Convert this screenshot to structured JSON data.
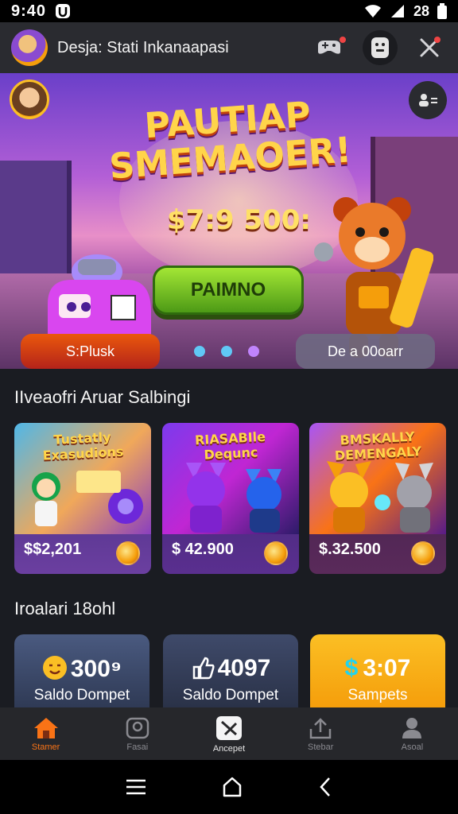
{
  "status_bar": {
    "time": "9:40",
    "battery_text": "28"
  },
  "app_bar": {
    "title": "Desja: Stati Inkanaapasi"
  },
  "hero": {
    "title_line1": "PAUTIAP",
    "title_line2": "SMEMAOER!",
    "prize": "$7:9 500:",
    "play_label": "PAIMNO",
    "left_button": "S:Plusk",
    "right_button": "De a 00oarr",
    "dot_colors": [
      "#60c8f5",
      "#60c8f5",
      "#c084fc"
    ]
  },
  "section_games": {
    "title": "IIveaofri Aruar Salbingi",
    "cards": [
      {
        "title": "Tustatly Exasudions",
        "price": "$$2,201"
      },
      {
        "title": "RIASABIle Dequnc",
        "price": "$ 42.900"
      },
      {
        "title": "BMSKALLY DEMENGALY",
        "price": "$.32.500"
      }
    ]
  },
  "section_balance": {
    "title": "Iroalari 18ohl",
    "cards": [
      {
        "value": "300⁹",
        "label": "Saldo Dompet",
        "icon": "emoji-face-icon"
      },
      {
        "value": "4097",
        "label": "Saldo Dompet",
        "icon": "thumbs-up-icon"
      },
      {
        "value": "3:07",
        "label": "Sampets",
        "icon": "dollar-icon"
      }
    ]
  },
  "bottom_nav": [
    {
      "label": "Stamer",
      "icon": "home-icon"
    },
    {
      "label": "Fasai",
      "icon": "frame-icon"
    },
    {
      "label": "Ancepet",
      "icon": "card-icon"
    },
    {
      "label": "Stebar",
      "icon": "upload-icon"
    },
    {
      "label": "Asoal",
      "icon": "profile-icon"
    }
  ],
  "colors": {
    "accent": "#f97316",
    "play_green": "#4d9a16",
    "gold": "#ffd54a"
  }
}
